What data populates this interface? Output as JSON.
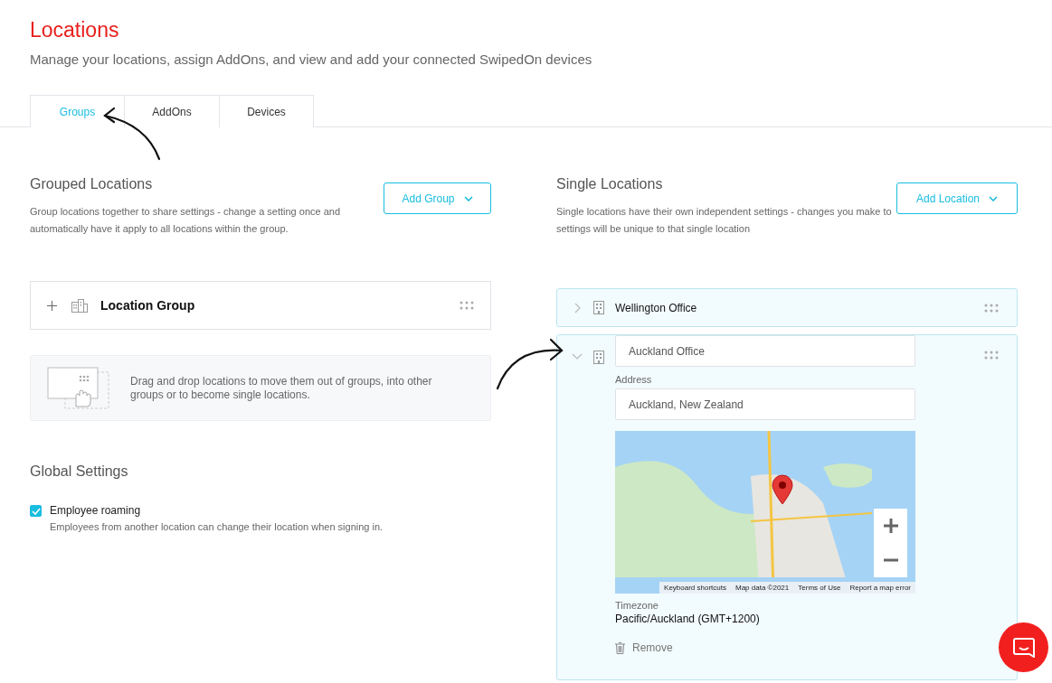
{
  "page": {
    "title": "Locations",
    "subtitle": "Manage your locations, assign AddOns, and view and add your connected SwipedOn devices"
  },
  "tabs": [
    {
      "label": "Groups",
      "selected": true
    },
    {
      "label": "AddOns",
      "selected": false
    },
    {
      "label": "Devices",
      "selected": false
    }
  ],
  "grouped": {
    "title": "Grouped Locations",
    "description": "Group locations together to share settings - change a setting once and automatically have it apply to all locations within the group.",
    "button": "Add Group",
    "groups": [
      {
        "name": "Location Group",
        "expanded": false
      }
    ],
    "hint": "Drag and drop locations to move them out of groups, into other groups or to become single locations."
  },
  "global_settings": {
    "title": "Global Settings",
    "options": [
      {
        "label": "Employee roaming",
        "description": "Employees from another location can change their location when signing in.",
        "checked": true
      }
    ]
  },
  "single": {
    "title": "Single Locations",
    "description": "Single locations have their own independent settings - changes you make to settings will be unique to that single location",
    "button": "Add Location",
    "locations": [
      {
        "name": "Wellington Office",
        "expanded": false
      },
      {
        "name": "Auckland Office",
        "expanded": true,
        "address_label": "Address",
        "address": "Auckland, New Zealand",
        "map_attribution": [
          "Keyboard shortcuts",
          "Map data ©2021",
          "Terms of Use",
          "Report a map error"
        ],
        "timezone_label": "Timezone",
        "timezone": "Pacific/Auckland (GMT+1200)",
        "remove": "Remove"
      }
    ]
  }
}
